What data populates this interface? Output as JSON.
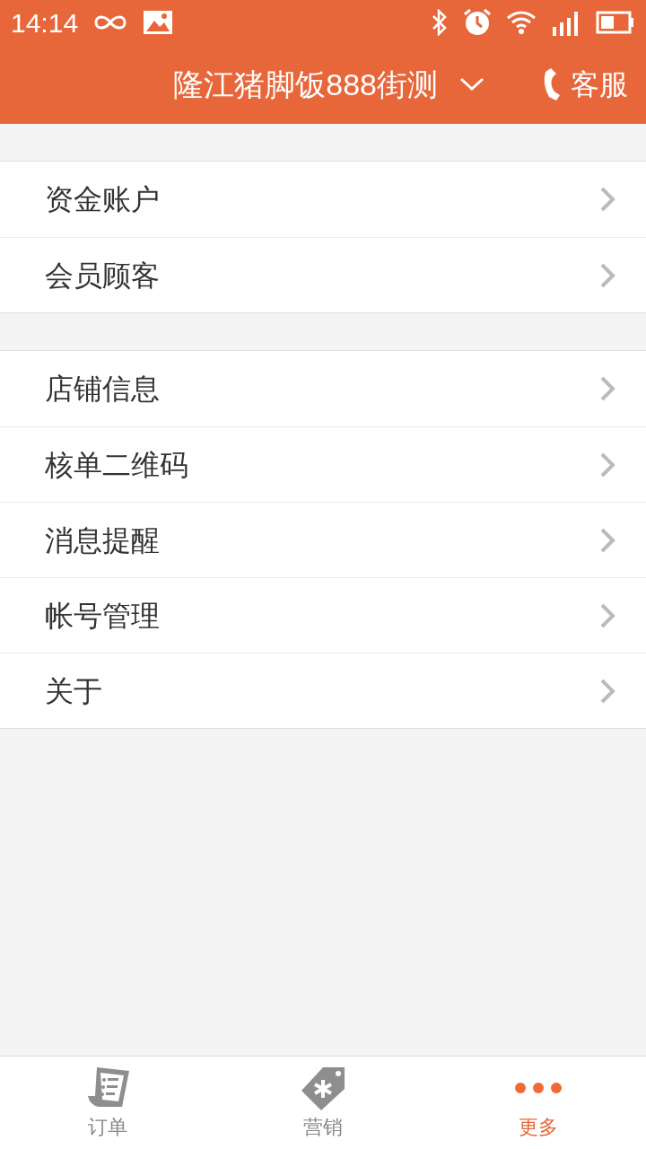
{
  "status_bar": {
    "time": "14:14"
  },
  "header": {
    "title": "隆江猪脚饭888街测",
    "service": "客服"
  },
  "menu_groups": [
    {
      "items": [
        {
          "label": "资金账户"
        },
        {
          "label": "会员顾客"
        }
      ]
    },
    {
      "items": [
        {
          "label": "店铺信息"
        },
        {
          "label": "核单二维码"
        },
        {
          "label": "消息提醒"
        },
        {
          "label": "帐号管理"
        },
        {
          "label": "关于"
        }
      ]
    }
  ],
  "tabs": [
    {
      "label": "订单",
      "kind": "receipt",
      "selected": false
    },
    {
      "label": "营销",
      "kind": "tag",
      "selected": false
    },
    {
      "label": "更多",
      "kind": "more",
      "selected": true
    }
  ]
}
